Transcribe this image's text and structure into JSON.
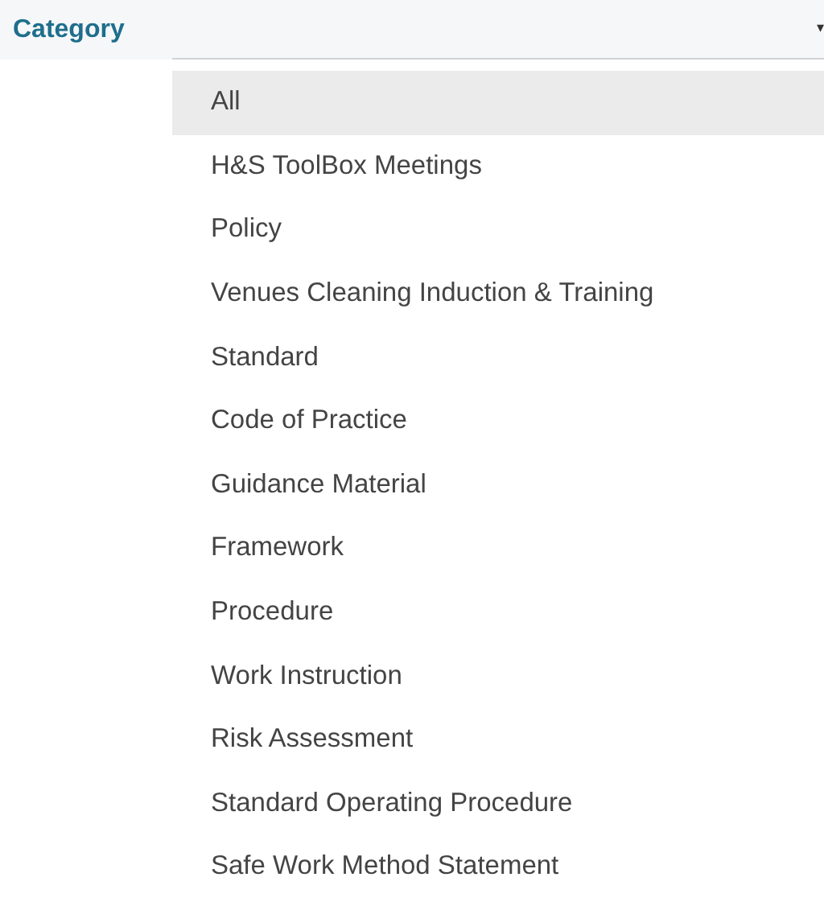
{
  "filter": {
    "label": "Category",
    "caret": "▾"
  },
  "options": [
    {
      "label": "All",
      "selected": true
    },
    {
      "label": "H&S ToolBox Meetings",
      "selected": false
    },
    {
      "label": "Policy",
      "selected": false
    },
    {
      "label": "Venues Cleaning Induction & Training",
      "selected": false
    },
    {
      "label": "Standard",
      "selected": false
    },
    {
      "label": "Code of Practice",
      "selected": false
    },
    {
      "label": "Guidance Material",
      "selected": false
    },
    {
      "label": "Framework",
      "selected": false
    },
    {
      "label": "Procedure",
      "selected": false
    },
    {
      "label": "Work Instruction",
      "selected": false
    },
    {
      "label": "Risk Assessment",
      "selected": false
    },
    {
      "label": "Standard Operating Procedure",
      "selected": false
    },
    {
      "label": "Safe Work Method Statement",
      "selected": false
    }
  ]
}
